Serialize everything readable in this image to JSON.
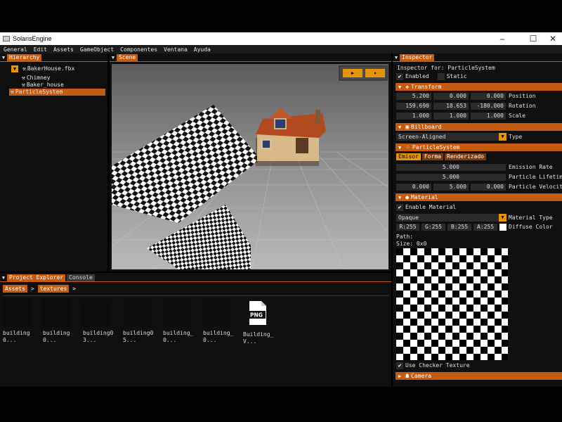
{
  "window": {
    "title": "SolarisEngine",
    "controls": [
      "–",
      "☐",
      "✕"
    ]
  },
  "menu": [
    "General",
    "Edit",
    "Assets",
    "GameObject",
    "Componentes",
    "Ventana",
    "Ayuda"
  ],
  "hierarchy": {
    "tab": "Hierarchy",
    "items": [
      {
        "label": "BakerHouse.fbx",
        "level": 0,
        "expanded": true
      },
      {
        "label": "Chimney",
        "level": 1
      },
      {
        "label": "Baker_house",
        "level": 1
      },
      {
        "label": "ParticleSystem",
        "level": 0,
        "selected": true
      }
    ]
  },
  "scene": {
    "tab": "Scene",
    "play_icon": "▶",
    "pause_icon": "⏸"
  },
  "project": {
    "tabs": [
      "Project Explorer",
      "Console"
    ],
    "breadcrumb": [
      "Assets",
      "textures"
    ],
    "breadcrumb_sep": ">",
    "assets": [
      {
        "name": "building\n0...",
        "type": "dark"
      },
      {
        "name": "building\n0...",
        "type": "dark"
      },
      {
        "name": "building0\n3...",
        "type": "dark"
      },
      {
        "name": "building0\n5...",
        "type": "dark"
      },
      {
        "name": "building_\n0...",
        "type": "dark"
      },
      {
        "name": "building_\n0...",
        "type": "dark"
      },
      {
        "name": "Building_\nV...",
        "type": "png",
        "badge": "PNG"
      }
    ]
  },
  "inspector": {
    "tab": "Inspector",
    "header": "Inspector for: ParticleSystem",
    "enabled_label": "Enabled",
    "static_label": "Static",
    "transform": {
      "title": "Transform",
      "position": [
        "5.200",
        "0.000",
        "0.000"
      ],
      "rotation": [
        "159.690",
        "18.653",
        "-180.000"
      ],
      "scale": [
        "1.000",
        "1.000",
        "1.000"
      ],
      "labels": [
        "Position",
        "Rotation",
        "Scale"
      ]
    },
    "billboard": {
      "title": "Billboard",
      "type_value": "Screen-Aligned",
      "type_label": "Type"
    },
    "particle_system": {
      "title": "ParticleSystem",
      "tabs": [
        "Emisor",
        "Forma",
        "Renderizado"
      ],
      "emission_rate": "5.000",
      "emission_rate_label": "Emission Rate",
      "particle_lifetime": "5.000",
      "particle_lifetime_label": "Particle Lifetime",
      "velocity": [
        "0.000",
        "5.000",
        "0.000"
      ],
      "velocity_label": "Particle Velocity"
    },
    "material": {
      "title": "Material",
      "enable_label": "Enable Material",
      "type_value": "Opaque",
      "type_label": "Material Type",
      "color": [
        "R:255",
        "G:255",
        "B:255",
        "A:255"
      ],
      "color_label": "Diffuse Color",
      "path_label": "Path:",
      "size_label": "Size: 0x0",
      "checker_label": "Use Checker Texture"
    },
    "camera": {
      "title": "Camera"
    }
  },
  "colors": {
    "accent": "#c55a11",
    "button": "#e8930c",
    "panel": "#0f0f0f",
    "field": "#2a2a2a"
  }
}
